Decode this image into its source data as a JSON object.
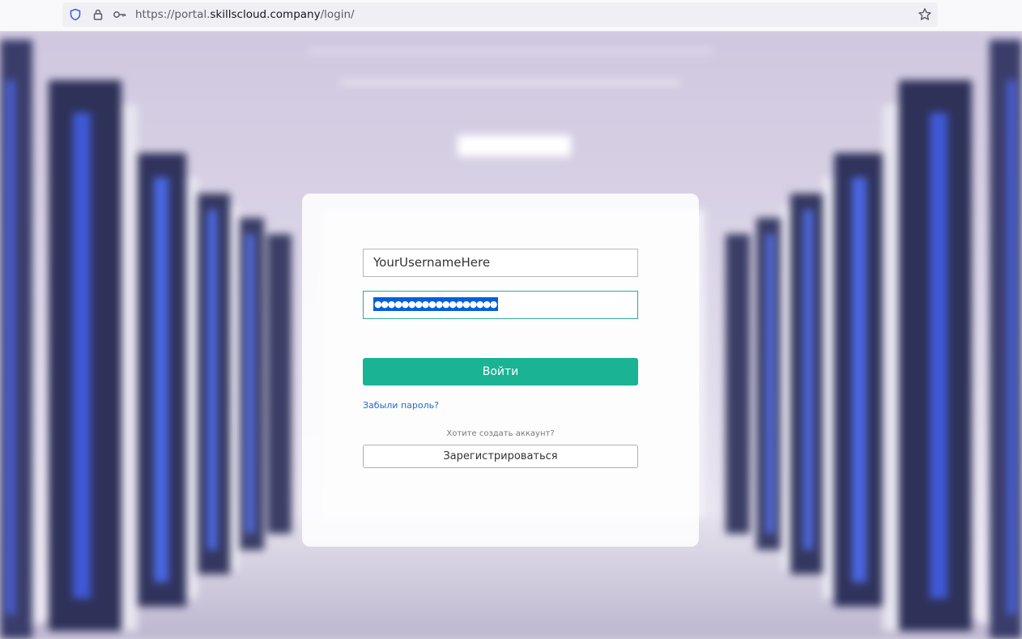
{
  "browser": {
    "url_prefix": "https://portal.",
    "url_domain": "skillscloud.company",
    "url_path": "/login/",
    "icons": [
      "shield-icon",
      "lock-icon",
      "key-icon",
      "star-icon"
    ]
  },
  "login": {
    "username_value": "YourUsernameHere",
    "password_value": "●●●●●●●●●●●●●●●●●●",
    "login_button": "Войти",
    "forgot_link": "Забыли пароль?",
    "signup_question": "Хотите создать аккаунт?",
    "register_button": "Зарегистрироваться"
  },
  "colors": {
    "accent": "#1ab394",
    "link": "#1c6ec5",
    "selection": "#0060df"
  }
}
